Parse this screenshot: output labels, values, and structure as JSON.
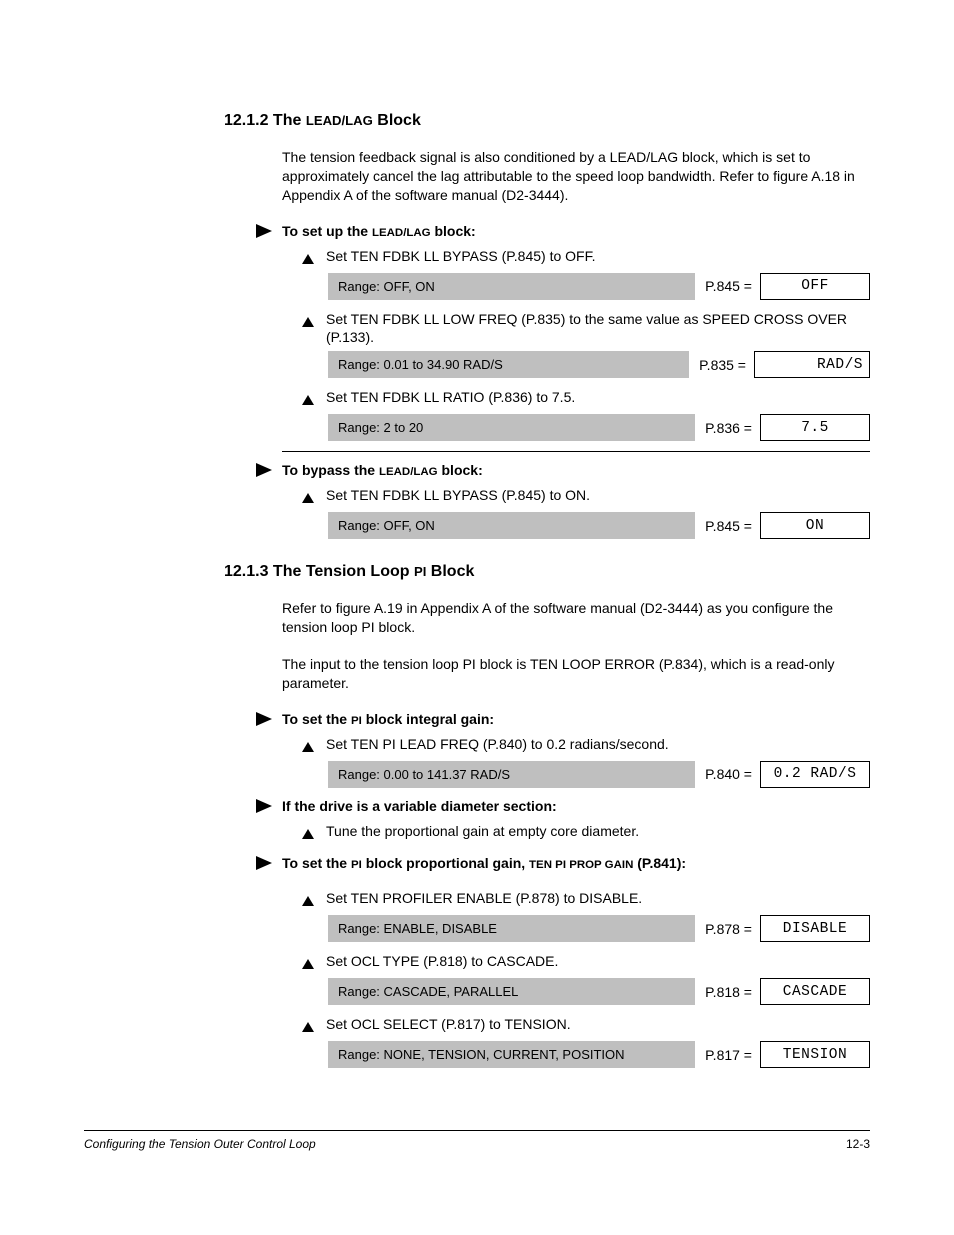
{
  "section1": {
    "heading_num": "12.1.2 The ",
    "heading_sc": "LEAD/LAG",
    "heading_end": " Block",
    "intro": "The tension feedback signal is also conditioned by a LEAD/LAG block, which is set to approximately cancel the lag attributable to the speed loop bandwidth. Refer to figure A.18 in Appendix A of the software manual (D2-3444).",
    "proc1_title_a": "To set up the ",
    "proc1_title_b": "LEAD/LAG",
    "proc1_title_c": " block:",
    "step1": "Set TEN FDBK LL BYPASS (P.845) to OFF.",
    "range1": "Range: OFF, ON",
    "p1": "P.845 =",
    "v1": "OFF",
    "step2": "Set TEN FDBK LL LOW FREQ (P.835) to the same value as SPEED CROSS OVER (P.133).",
    "range2": "Range: 0.01 to 34.90 RAD/S",
    "p2": "P.835 =",
    "v2": "RAD/S",
    "step3": "Set TEN FDBK LL RATIO (P.836) to 7.5.",
    "range3": "Range: 2 to 20",
    "p3": "P.836 =",
    "v3": "7.5",
    "proc2_title_a": "To bypass the ",
    "proc2_title_b": "LEAD/LAG",
    "proc2_title_c": " block:",
    "step4": "Set TEN FDBK LL BYPASS (P.845) to ON.",
    "range4": "Range: OFF, ON",
    "p4": "P.845 =",
    "v4": "ON"
  },
  "section2": {
    "heading_num": "12.1.3 The Tension Loop ",
    "heading_sc": "PI",
    "heading_end": " Block",
    "intro1": "Refer to figure A.19 in Appendix A of the software manual (D2-3444) as you configure the tension loop PI block.",
    "intro2": "The input to the tension loop PI block is TEN LOOP ERROR (P.834), which is a read-only parameter.",
    "proc1_a": "To set the ",
    "proc1_b": "PI",
    "proc1_c": " block integral gain:",
    "step1": "Set TEN PI LEAD FREQ (P.840) to 0.2 radians/second.",
    "range1": "Range: 0.00 to 141.37 RAD/S",
    "p1": "P.840 =",
    "v1": "0.2 RAD/S",
    "proc2": "If the drive is a variable diameter section:",
    "step2": "Tune the proportional gain at empty core diameter.",
    "proc3_a": "To set the ",
    "proc3_b": "PI",
    "proc3_c": " block proportional gain, ",
    "proc3_d": "TEN PI PROP GAIN",
    "proc3_e": " (P.841):",
    "step3": "Set TEN PROFILER ENABLE (P.878) to DISABLE.",
    "range3": "Range: ENABLE, DISABLE",
    "p3": "P.878 =",
    "v3": "DISABLE",
    "step4": "Set OCL TYPE (P.818) to CASCADE.",
    "range4": "Range: CASCADE, PARALLEL",
    "p4": "P.818 =",
    "v4": "CASCADE",
    "step5": "Set OCL SELECT (P.817) to TENSION.",
    "range5": "Range: NONE, TENSION, CURRENT, POSITION",
    "p5": "P.817 =",
    "v5": "TENSION"
  },
  "footer": {
    "title": "Configuring the Tension Outer Control Loop",
    "page": "12-3"
  }
}
